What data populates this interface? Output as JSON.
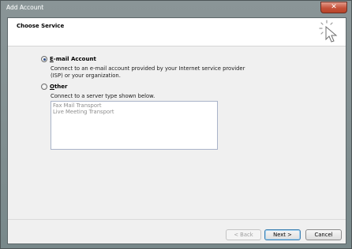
{
  "window": {
    "title": "Add Account",
    "close_glyph": "✕"
  },
  "header": {
    "title": "Choose Service",
    "icon": "cursor-sparkle-icon"
  },
  "options": {
    "email": {
      "label_accel": "E",
      "label_rest": "-mail Account",
      "selected": true,
      "description_line1": "Connect to an e-mail account provided by your Internet service provider",
      "description_line2": "(ISP) or your organization."
    },
    "other": {
      "label_accel": "O",
      "label_rest": "ther",
      "selected": false,
      "description": "Connect to a server type shown below.",
      "server_types": [
        "Fax Mail Transport",
        "Live Meeting Transport"
      ]
    }
  },
  "buttons": {
    "back": "< Back",
    "next": "Next >",
    "cancel": "Cancel"
  },
  "colors": {
    "title_bar": "#7f8a8c",
    "close_button": "#c6523a",
    "dialog_bg": "#f0f0f0",
    "header_bg": "#ffffff"
  }
}
